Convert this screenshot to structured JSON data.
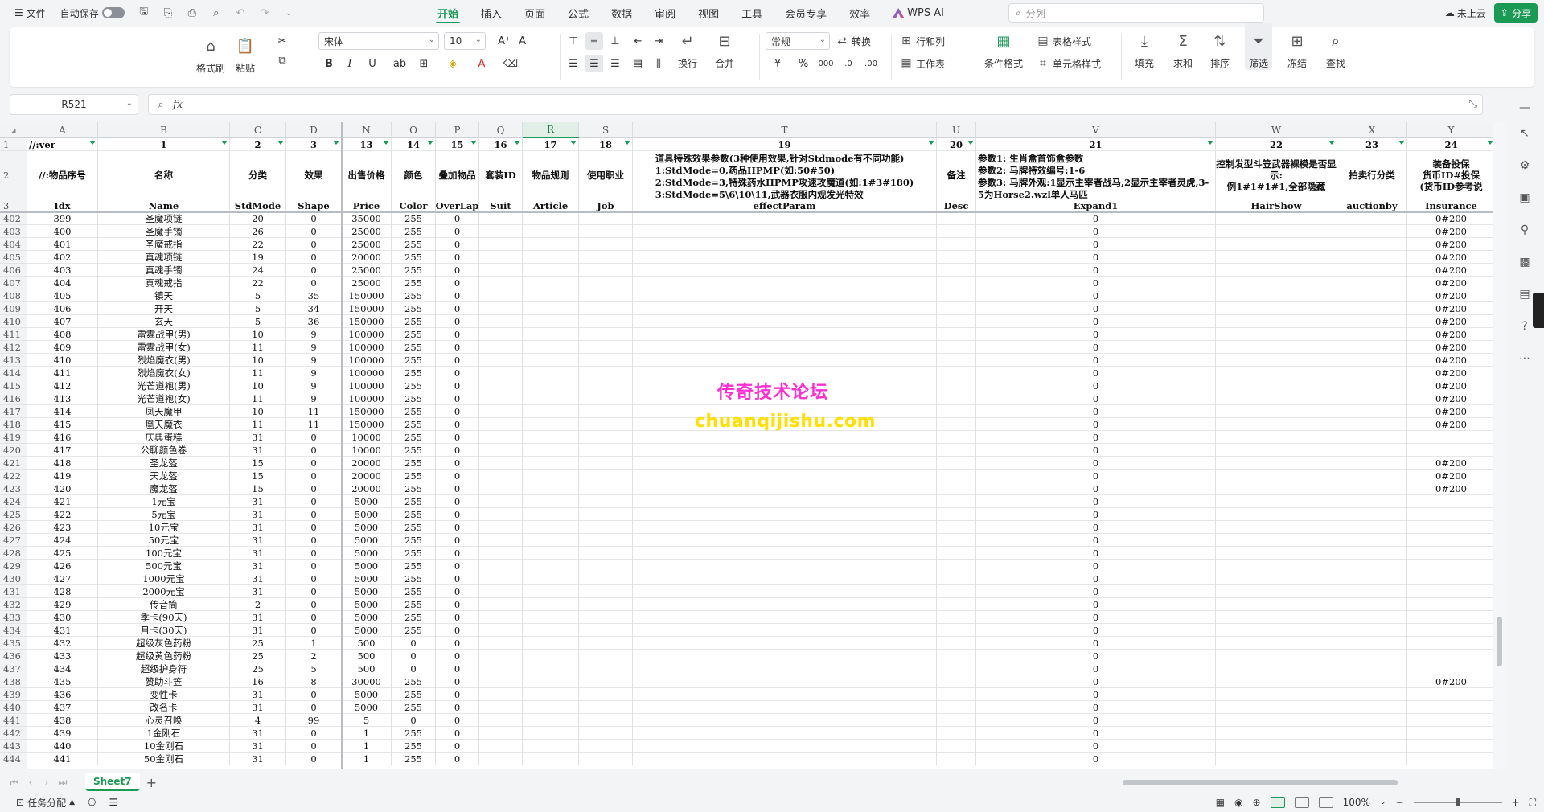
{
  "titlebar": {
    "file_menu": "文件",
    "autosave_label": "自动保存",
    "menus": [
      "开始",
      "插入",
      "页面",
      "公式",
      "数据",
      "审阅",
      "视图",
      "工具",
      "会员专享",
      "效率"
    ],
    "active_menu": "开始",
    "wps_ai": "WPS AI",
    "search_placeholder": "分列",
    "cloud_status": "未上云",
    "share_label": "分享"
  },
  "ribbon": {
    "format_painter": "格式刷",
    "paste": "粘贴",
    "font_name": "宋体",
    "font_size": "10",
    "number_format": "常规",
    "convert": "转换",
    "row_col": "行和列",
    "table_style": "表格样式",
    "wrap": "换行",
    "merge": "合并",
    "worksheet": "工作表",
    "cond_format": "条件格式",
    "cell_style": "单元格样式",
    "fill": "填充",
    "sum": "求和",
    "sort": "排序",
    "filter": "筛选",
    "freeze": "冻结",
    "find": "查找"
  },
  "formula_bar": {
    "cell_ref": "R521",
    "fx_label": "fx",
    "value": ""
  },
  "sheet": {
    "selected_column": "R",
    "columns": [
      "A",
      "B",
      "C",
      "D",
      "N",
      "O",
      "P",
      "Q",
      "R",
      "S",
      "T",
      "U",
      "V",
      "W",
      "X",
      "Y"
    ],
    "row1": [
      "//:ver",
      "1",
      "2",
      "3",
      "13",
      "14",
      "15",
      "16",
      "17",
      "18",
      "19",
      "20",
      "21",
      "22",
      "23",
      "24"
    ],
    "row2": [
      "//:物品序号",
      "名称",
      "分类",
      "效果",
      "出售价格",
      "颜色",
      "叠加物品",
      "套装ID",
      "物品规则",
      "使用职业",
      "道具特殊效果参数(3种使用效果,针对Stdmode有不同功能)\n1:StdMode=0,药品HPMP(如:50#50)\n2:StdMode=3,特殊药水HPMP攻速攻魔道(如:1#3#180)\n3:StdMode=5\\6\\10\\11,武器衣服内观发光特效",
      "备注",
      "参数1: 生肖盒首饰盒参数\n参数2: 马牌特效编号:1-6\n参数3: 马牌外观:1显示主宰者战马,2显示主宰者灵虎,3-5为Horse2.wzl单人马匹",
      "控制发型斗笠武器裸模是否显示:\n例1#1#1#1,全部隐藏",
      "拍卖行分类",
      "装备投保\n货币ID#投保\n(货币ID参考说"
    ],
    "row3": [
      "Idx",
      "Name",
      "StdMode",
      "Shape",
      "Price",
      "Color",
      "OverLap",
      "Suit",
      "Article",
      "Job",
      "effectParam",
      "Desc",
      "Expand1",
      "HairShow",
      "auctionby",
      "Insurance"
    ],
    "row_numbers": [
      "1",
      "2",
      "3",
      "402",
      "403",
      "404",
      "405",
      "406",
      "407",
      "408",
      "409",
      "410",
      "411",
      "412",
      "413",
      "414",
      "415",
      "416",
      "417",
      "418",
      "419",
      "420",
      "421",
      "422",
      "423",
      "424",
      "425",
      "426",
      "427",
      "428",
      "429",
      "430",
      "431",
      "432",
      "433",
      "434",
      "435",
      "436",
      "437",
      "438",
      "439",
      "440",
      "441",
      "442",
      "443",
      "444"
    ],
    "rows": [
      [
        "399",
        "圣魔项链",
        "20",
        "0",
        "35000",
        "255",
        "0",
        "0",
        "0#200"
      ],
      [
        "400",
        "圣魔手镯",
        "26",
        "0",
        "25000",
        "255",
        "0",
        "0",
        "0#200"
      ],
      [
        "401",
        "圣魔戒指",
        "22",
        "0",
        "25000",
        "255",
        "0",
        "0",
        "0#200"
      ],
      [
        "402",
        "真魂项链",
        "19",
        "0",
        "20000",
        "255",
        "0",
        "0",
        "0#200"
      ],
      [
        "403",
        "真魂手镯",
        "24",
        "0",
        "25000",
        "255",
        "0",
        "0",
        "0#200"
      ],
      [
        "404",
        "真魂戒指",
        "22",
        "0",
        "25000",
        "255",
        "0",
        "0",
        "0#200"
      ],
      [
        "405",
        "镇天",
        "5",
        "35",
        "150000",
        "255",
        "0",
        "0",
        "0#200"
      ],
      [
        "406",
        "开天",
        "5",
        "34",
        "150000",
        "255",
        "0",
        "0",
        "0#200"
      ],
      [
        "407",
        "玄天",
        "5",
        "36",
        "150000",
        "255",
        "0",
        "0",
        "0#200"
      ],
      [
        "408",
        "雷霆战甲(男)",
        "10",
        "9",
        "100000",
        "255",
        "0",
        "0",
        "0#200"
      ],
      [
        "409",
        "雷霆战甲(女)",
        "11",
        "9",
        "100000",
        "255",
        "0",
        "0",
        "0#200"
      ],
      [
        "410",
        "烈焰魔衣(男)",
        "10",
        "9",
        "100000",
        "255",
        "0",
        "0",
        "0#200"
      ],
      [
        "411",
        "烈焰魔衣(女)",
        "11",
        "9",
        "100000",
        "255",
        "0",
        "0",
        "0#200"
      ],
      [
        "412",
        "光芒道袍(男)",
        "10",
        "9",
        "100000",
        "255",
        "0",
        "0",
        "0#200"
      ],
      [
        "413",
        "光芒道袍(女)",
        "11",
        "9",
        "100000",
        "255",
        "0",
        "0",
        "0#200"
      ],
      [
        "414",
        "凤天魔甲",
        "10",
        "11",
        "150000",
        "255",
        "0",
        "0",
        "0#200"
      ],
      [
        "415",
        "凰天魔衣",
        "11",
        "11",
        "150000",
        "255",
        "0",
        "0",
        "0#200"
      ],
      [
        "416",
        "庆典蛋糕",
        "31",
        "0",
        "10000",
        "255",
        "0",
        "0",
        ""
      ],
      [
        "417",
        "公聊颜色卷",
        "31",
        "0",
        "10000",
        "255",
        "0",
        "0",
        ""
      ],
      [
        "418",
        "圣龙盔",
        "15",
        "0",
        "20000",
        "255",
        "0",
        "0",
        "0#200"
      ],
      [
        "419",
        "天龙盔",
        "15",
        "0",
        "20000",
        "255",
        "0",
        "0",
        "0#200"
      ],
      [
        "420",
        "魔龙盔",
        "15",
        "0",
        "20000",
        "255",
        "0",
        "0",
        "0#200"
      ],
      [
        "421",
        "1元宝",
        "31",
        "0",
        "5000",
        "255",
        "0",
        "0",
        ""
      ],
      [
        "422",
        "5元宝",
        "31",
        "0",
        "5000",
        "255",
        "0",
        "0",
        ""
      ],
      [
        "423",
        "10元宝",
        "31",
        "0",
        "5000",
        "255",
        "0",
        "0",
        ""
      ],
      [
        "424",
        "50元宝",
        "31",
        "0",
        "5000",
        "255",
        "0",
        "0",
        ""
      ],
      [
        "425",
        "100元宝",
        "31",
        "0",
        "5000",
        "255",
        "0",
        "0",
        ""
      ],
      [
        "426",
        "500元宝",
        "31",
        "0",
        "5000",
        "255",
        "0",
        "0",
        ""
      ],
      [
        "427",
        "1000元宝",
        "31",
        "0",
        "5000",
        "255",
        "0",
        "0",
        ""
      ],
      [
        "428",
        "2000元宝",
        "31",
        "0",
        "5000",
        "255",
        "0",
        "0",
        ""
      ],
      [
        "429",
        "传音筒",
        "2",
        "0",
        "5000",
        "255",
        "0",
        "0",
        ""
      ],
      [
        "430",
        "季卡(90天)",
        "31",
        "0",
        "5000",
        "255",
        "0",
        "0",
        ""
      ],
      [
        "431",
        "月卡(30天)",
        "31",
        "0",
        "5000",
        "255",
        "0",
        "0",
        ""
      ],
      [
        "432",
        "超级灰色药粉",
        "25",
        "1",
        "500",
        "0",
        "0",
        "0",
        ""
      ],
      [
        "433",
        "超级黄色药粉",
        "25",
        "2",
        "500",
        "0",
        "0",
        "0",
        ""
      ],
      [
        "434",
        "超级护身符",
        "25",
        "5",
        "500",
        "0",
        "0",
        "0",
        ""
      ],
      [
        "435",
        "赞助斗笠",
        "16",
        "8",
        "30000",
        "255",
        "0",
        "0",
        "0#200"
      ],
      [
        "436",
        "变性卡",
        "31",
        "0",
        "5000",
        "255",
        "0",
        "0",
        ""
      ],
      [
        "437",
        "改名卡",
        "31",
        "0",
        "5000",
        "255",
        "0",
        "0",
        ""
      ],
      [
        "438",
        "心灵召唤",
        "4",
        "99",
        "5",
        "0",
        "0",
        "0",
        ""
      ],
      [
        "439",
        "1金刚石",
        "31",
        "0",
        "1",
        "255",
        "0",
        "0",
        ""
      ],
      [
        "440",
        "10金刚石",
        "31",
        "0",
        "1",
        "255",
        "0",
        "0",
        ""
      ],
      [
        "441",
        "50金刚石",
        "31",
        "0",
        "1",
        "255",
        "0",
        "0",
        ""
      ]
    ]
  },
  "watermark": {
    "line1": "传奇技术论坛",
    "line2": "chuanqijishu.com"
  },
  "tabs": {
    "sheet_name": "Sheet7"
  },
  "status": {
    "task": "任务分配",
    "zoom": "100%"
  },
  "colors": {
    "accent": "#1a9a55",
    "watermark1": "#ff2fd2",
    "watermark2": "#ffe000"
  }
}
